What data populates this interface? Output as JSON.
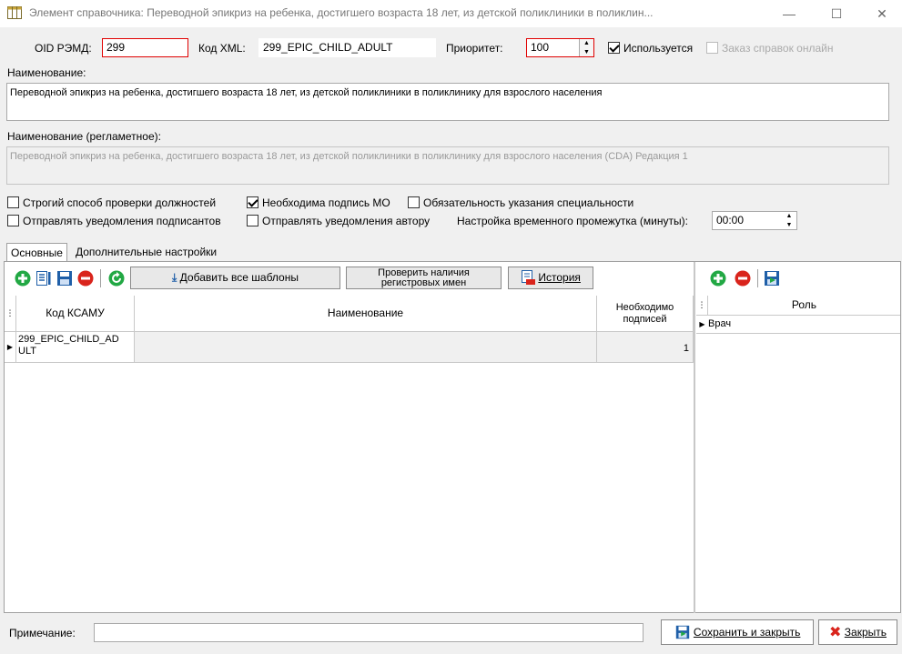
{
  "window": {
    "title": "Элемент справочника: Переводной эпикриз на ребенка, достигшего возраста 18 лет, из детской поликлиники в поликлин...",
    "minimize": "—",
    "maximize": "☐",
    "close": "✕"
  },
  "form": {
    "oid_label": "OID РЭМД:",
    "oid_value": "299",
    "xml_label": "Код XML:",
    "xml_value": "299_EPIC_CHILD_ADULT",
    "priority_label": "Приоритет:",
    "priority_value": "100",
    "used_label": "Используется",
    "online_label": "Заказ справок онлайн",
    "name_label": "Наименование:",
    "name_value": "Переводной эпикриз на ребенка, достигшего возраста 18 лет, из детской поликлиники в поликлинику для взрослого населения",
    "reg_name_label": "Наименование (регламетное):",
    "reg_name_value": "Переводной эпикриз на ребенка, достигшего возраста 18 лет, из детской поликлиники в поликлинику для взрослого населения (CDA) Редакция 1",
    "strict_label": "Строгий способ проверки должностей",
    "sign_mo_label": "Необходима подпись МО",
    "specialty_label": "Обязательность указания специальности",
    "notify_signers_label": "Отправлять уведомления подписантов",
    "notify_author_label": "Отправлять уведомления автору",
    "time_label": "Настройка временного промежутка (минуты):",
    "time_value": "00:00"
  },
  "tabs": [
    {
      "label": "Основные"
    },
    {
      "label": "Дополнительные настройки"
    }
  ],
  "toolbar": {
    "add_all_templates": "Добавить все шаблоны",
    "check_names_line1": "Проверить наличия",
    "check_names_line2": "регистровых имен",
    "history": "История"
  },
  "grid": {
    "col_code": "Код КСАМУ",
    "col_name": "Наименование",
    "col_signs_line1": "Необходимо",
    "col_signs_line2": "подписей",
    "rows": [
      {
        "code_line1": "299_EPIC_CHILD_AD",
        "code_line2": "ULT",
        "name": "",
        "signs": "1"
      }
    ]
  },
  "roles": {
    "col_role": "Роль",
    "rows": [
      {
        "role": "Врач"
      }
    ]
  },
  "footer": {
    "note_label": "Примечание:",
    "note_value": "",
    "save_close": "Сохранить и закрыть",
    "close": "Закрыть"
  },
  "colors": {
    "required_border": "#e00000",
    "add_green": "#22a844",
    "remove_red": "#d9241c",
    "save_blue": "#1f5fa8"
  }
}
